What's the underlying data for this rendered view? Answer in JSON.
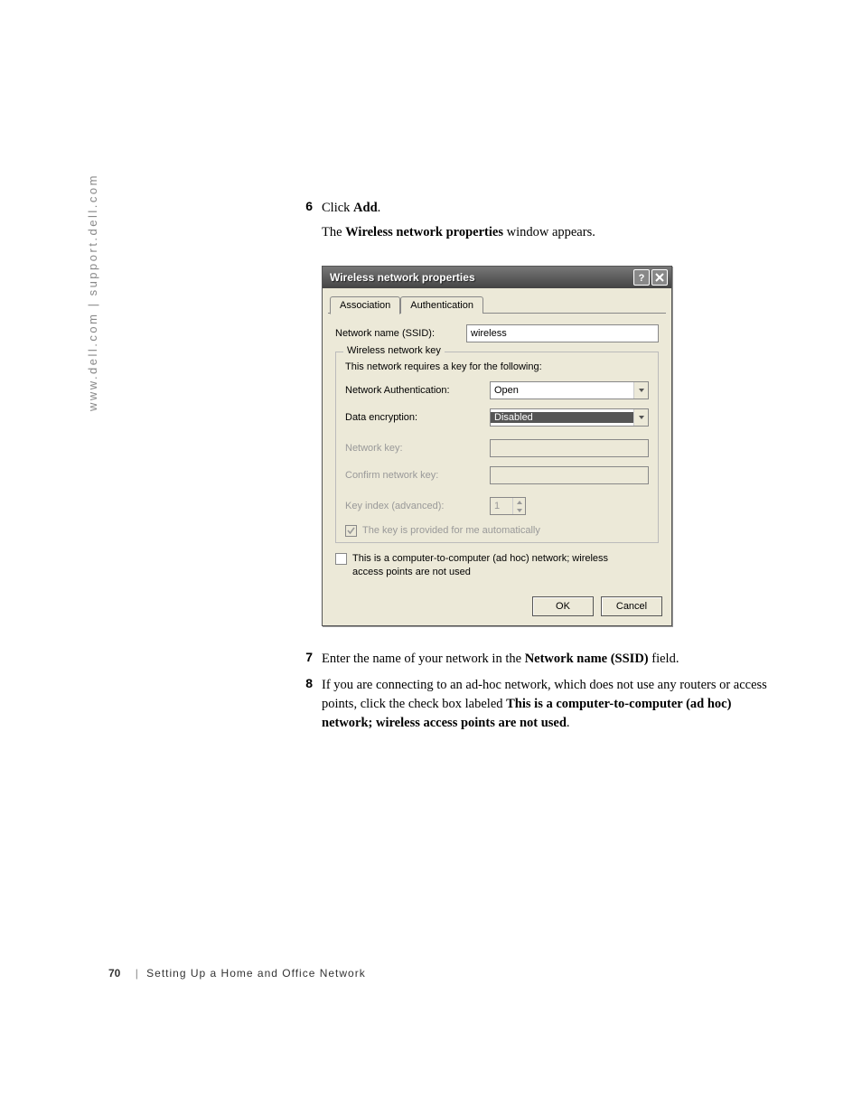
{
  "sidebar_footer": "www.dell.com | support.dell.com",
  "steps": {
    "s6": {
      "num": "6",
      "prefix": "Click ",
      "bold1": "Add",
      "suffix": "."
    },
    "s6sub_pre": "The ",
    "s6sub_bold": "Wireless network properties",
    "s6sub_post": " window appears.",
    "s7": {
      "num": "7",
      "pre": "Enter the name of your network in the ",
      "bold": "Network name (SSID)",
      "post": " field."
    },
    "s8": {
      "num": "8",
      "pre": "If you are connecting to an ad-hoc network, which does not use any routers or access points, click the check box labeled ",
      "bold": "This is a computer-to-computer (ad hoc) network; wireless access points are not used",
      "post": "."
    }
  },
  "dialog": {
    "title": "Wireless network properties",
    "tabs": {
      "association": "Association",
      "authentication": "Authentication"
    },
    "fields": {
      "ssid_label": "Network name (SSID):",
      "ssid_value": "wireless",
      "groupbox_legend": "Wireless network key",
      "groupbox_helper": "This network requires a key for the following:",
      "auth_label": "Network Authentication:",
      "auth_value": "Open",
      "enc_label": "Data encryption:",
      "enc_value": "Disabled",
      "netkey_label": "Network key:",
      "confirm_label": "Confirm network key:",
      "keyindex_label": "Key index (advanced):",
      "keyindex_value": "1",
      "autokey_label": "The key is provided for me automatically",
      "adhoc_line1": "This is a computer-to-computer (ad hoc) network; wireless",
      "adhoc_line2": "access points are not used"
    },
    "buttons": {
      "ok": "OK",
      "cancel": "Cancel"
    }
  },
  "footer": {
    "page": "70",
    "separator": "|",
    "section": "Setting Up a Home and Office Network"
  }
}
